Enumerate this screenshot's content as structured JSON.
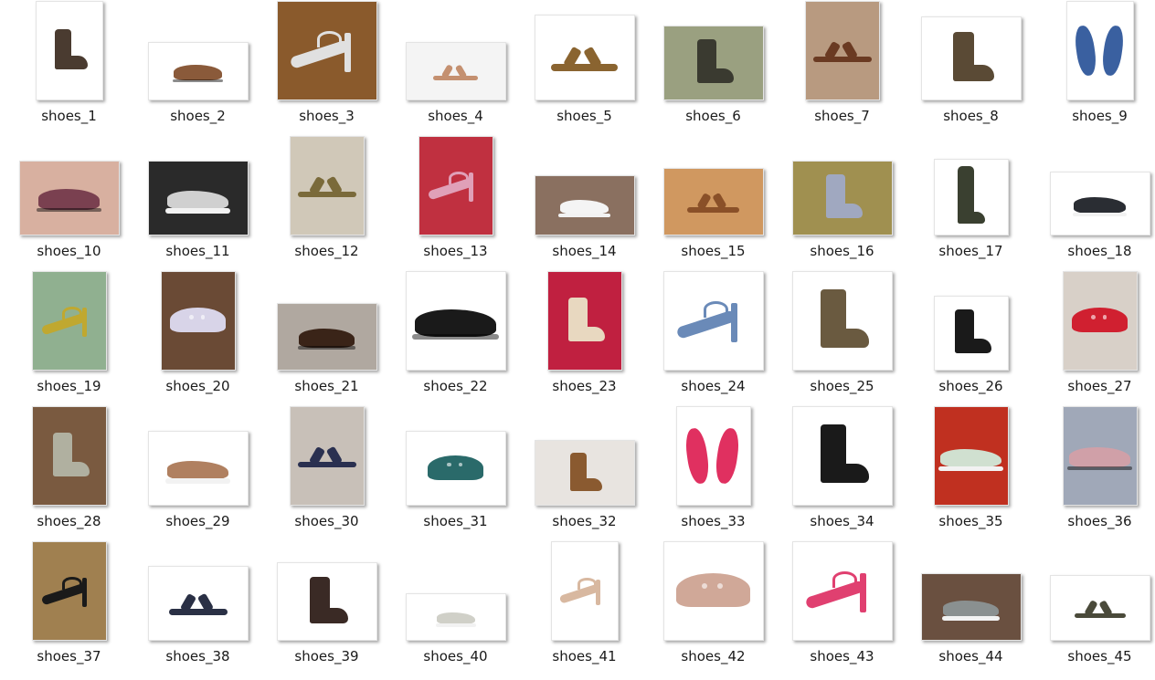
{
  "items": [
    {
      "label": "shoes_1",
      "icon": "boot-icon",
      "bg": "#ffffff",
      "fg": "#4a3b30"
    },
    {
      "label": "shoes_2",
      "icon": "slipper-icon",
      "bg": "#ffffff",
      "fg": "#8a5a3a"
    },
    {
      "label": "shoes_3",
      "icon": "clear-heel-icon",
      "bg": "#8a5a2c",
      "fg": "#e0e0e0"
    },
    {
      "label": "shoes_4",
      "icon": "sandal-icon",
      "bg": "#f4f4f4",
      "fg": "#c49070"
    },
    {
      "label": "shoes_5",
      "icon": "sandal-icon",
      "bg": "#ffffff",
      "fg": "#8a6430"
    },
    {
      "label": "shoes_6",
      "icon": "boot-icon",
      "bg": "#9aa080",
      "fg": "#3a3a30"
    },
    {
      "label": "shoes_7",
      "icon": "sandal-icon",
      "bg": "#b89a80",
      "fg": "#6a3a22"
    },
    {
      "label": "shoes_8",
      "icon": "boot-icon",
      "bg": "#ffffff",
      "fg": "#5a4a35"
    },
    {
      "label": "shoes_9",
      "icon": "flip-flop-icon",
      "bg": "#ffffff",
      "fg": "#3a60a0"
    },
    {
      "label": "shoes_10",
      "icon": "slipper-icon",
      "bg": "#d8b0a0",
      "fg": "#7a4050"
    },
    {
      "label": "shoes_11",
      "icon": "sneaker-icon",
      "bg": "#2a2a2a",
      "fg": "#d0d0d0"
    },
    {
      "label": "shoes_12",
      "icon": "sandal-icon",
      "bg": "#d0c8b8",
      "fg": "#7a6a3a"
    },
    {
      "label": "shoes_13",
      "icon": "heel-icon",
      "bg": "#c03040",
      "fg": "#e0a0b8"
    },
    {
      "label": "shoes_14",
      "icon": "sneaker-icon",
      "bg": "#8a7060",
      "fg": "#f4f4f4"
    },
    {
      "label": "shoes_15",
      "icon": "sandal-icon",
      "bg": "#d09860",
      "fg": "#8a5028"
    },
    {
      "label": "shoes_16",
      "icon": "boot-icon",
      "bg": "#a09050",
      "fg": "#a0a8c0"
    },
    {
      "label": "shoes_17",
      "icon": "tall-boot-icon",
      "bg": "#ffffff",
      "fg": "#3a4030"
    },
    {
      "label": "shoes_18",
      "icon": "sneaker-icon",
      "bg": "#ffffff",
      "fg": "#2a2d33"
    },
    {
      "label": "shoes_19",
      "icon": "heel-icon",
      "bg": "#90b090",
      "fg": "#c0a830"
    },
    {
      "label": "shoes_20",
      "icon": "clog-icon",
      "bg": "#6a4a35",
      "fg": "#d8d4e8"
    },
    {
      "label": "shoes_21",
      "icon": "dress-shoe-icon",
      "bg": "#b0a8a0",
      "fg": "#3a2418"
    },
    {
      "label": "shoes_22",
      "icon": "slipper-icon",
      "bg": "#ffffff",
      "fg": "#1a1a1a"
    },
    {
      "label": "shoes_23",
      "icon": "boot-icon",
      "bg": "#c02040",
      "fg": "#e8d8c0"
    },
    {
      "label": "shoes_24",
      "icon": "heel-icon",
      "bg": "#ffffff",
      "fg": "#6a8ab8"
    },
    {
      "label": "shoes_25",
      "icon": "boot-icon",
      "bg": "#ffffff",
      "fg": "#6a5a40"
    },
    {
      "label": "shoes_26",
      "icon": "boot-icon",
      "bg": "#ffffff",
      "fg": "#1a1a1a"
    },
    {
      "label": "shoes_27",
      "icon": "clog-icon",
      "bg": "#d8d0c8",
      "fg": "#d02030"
    },
    {
      "label": "shoes_28",
      "icon": "boot-icon",
      "bg": "#7a5a40",
      "fg": "#b0b0a0"
    },
    {
      "label": "shoes_29",
      "icon": "sneaker-icon",
      "bg": "#ffffff",
      "fg": "#b08060"
    },
    {
      "label": "shoes_30",
      "icon": "sandal-icon",
      "bg": "#c8c0b8",
      "fg": "#2a3050"
    },
    {
      "label": "shoes_31",
      "icon": "clog-icon",
      "bg": "#ffffff",
      "fg": "#2a6a6a"
    },
    {
      "label": "shoes_32",
      "icon": "boot-icon",
      "bg": "#e8e4e0",
      "fg": "#8a5a30"
    },
    {
      "label": "shoes_33",
      "icon": "flip-flop-icon",
      "bg": "#ffffff",
      "fg": "#e03060"
    },
    {
      "label": "shoes_34",
      "icon": "boot-icon",
      "bg": "#ffffff",
      "fg": "#1a1a1a"
    },
    {
      "label": "shoes_35",
      "icon": "sneaker-icon",
      "bg": "#c03020",
      "fg": "#d0e0d0"
    },
    {
      "label": "shoes_36",
      "icon": "flat-shoe-icon",
      "bg": "#a0a8b8",
      "fg": "#d0a0a8"
    },
    {
      "label": "shoes_37",
      "icon": "heel-icon",
      "bg": "#a08050",
      "fg": "#1a1a1a"
    },
    {
      "label": "shoes_38",
      "icon": "sandal-icon",
      "bg": "#ffffff",
      "fg": "#2a3045"
    },
    {
      "label": "shoes_39",
      "icon": "boot-icon",
      "bg": "#ffffff",
      "fg": "#3a2a25"
    },
    {
      "label": "shoes_40",
      "icon": "sneaker-icon",
      "bg": "#ffffff",
      "fg": "#d0d0c8"
    },
    {
      "label": "shoes_41",
      "icon": "heel-icon",
      "bg": "#ffffff",
      "fg": "#d8b8a0"
    },
    {
      "label": "shoes_42",
      "icon": "clog-icon",
      "bg": "#ffffff",
      "fg": "#d0a898"
    },
    {
      "label": "shoes_43",
      "icon": "heel-icon",
      "bg": "#ffffff",
      "fg": "#e04070"
    },
    {
      "label": "shoes_44",
      "icon": "sneaker-icon",
      "bg": "#6a5040",
      "fg": "#8a9090"
    },
    {
      "label": "shoes_45",
      "icon": "sandal-icon",
      "bg": "#ffffff",
      "fg": "#4a4a3a"
    }
  ]
}
